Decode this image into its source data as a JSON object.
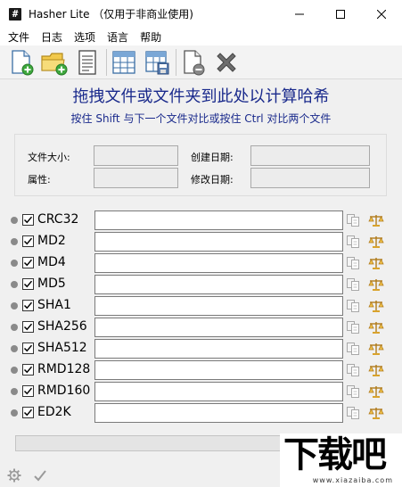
{
  "window": {
    "app_icon_glyph": "#",
    "title": "Hasher Lite （仅用于非商业使用)"
  },
  "menu": [
    "文件",
    "日志",
    "选项",
    "语言",
    "帮助"
  ],
  "toolbar": {
    "icons": [
      "new-file-icon",
      "open-folder-icon",
      "document-icon",
      "table-icon",
      "save-table-icon",
      "remove-file-icon",
      "clear-x-icon"
    ]
  },
  "drop": {
    "title": "拖拽文件或文件夹到此处以计算哈希",
    "subtitle": "按住 Shift 与下一个文件对比或按住 Ctrl 对比两个文件"
  },
  "info": {
    "size_label": "文件大小:",
    "attr_label": "属性:",
    "created_label": "创建日期:",
    "modified_label": "修改日期:",
    "size_value": "",
    "attr_value": "",
    "created_value": "",
    "modified_value": ""
  },
  "hashes": [
    {
      "name": "CRC32",
      "checked": true,
      "value": ""
    },
    {
      "name": "MD2",
      "checked": true,
      "value": ""
    },
    {
      "name": "MD4",
      "checked": true,
      "value": ""
    },
    {
      "name": "MD5",
      "checked": true,
      "value": ""
    },
    {
      "name": "SHA1",
      "checked": true,
      "value": ""
    },
    {
      "name": "SHA256",
      "checked": true,
      "value": ""
    },
    {
      "name": "SHA512",
      "checked": true,
      "value": ""
    },
    {
      "name": "RMD128",
      "checked": true,
      "value": ""
    },
    {
      "name": "RMD160",
      "checked": true,
      "value": ""
    },
    {
      "name": "ED2K",
      "checked": true,
      "value": ""
    }
  ],
  "progress": 0,
  "watermark": {
    "text": "下载吧",
    "url": "www.xiazaiba.com"
  }
}
